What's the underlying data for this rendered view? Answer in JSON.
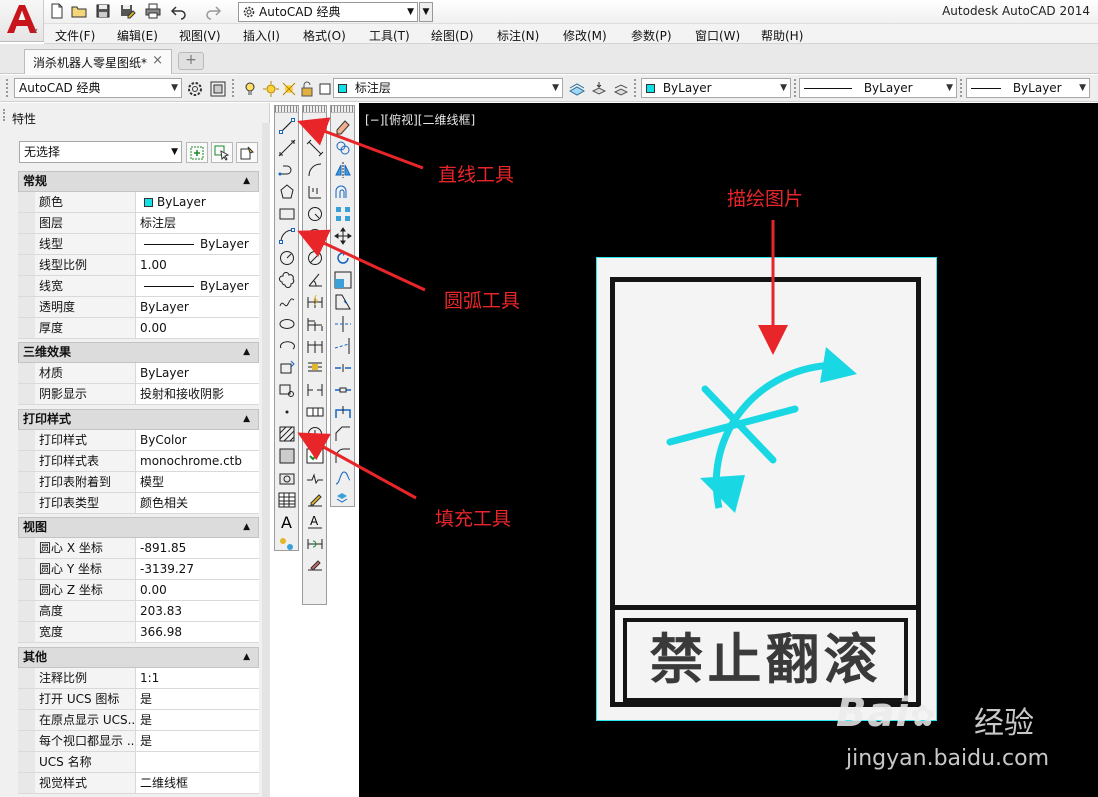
{
  "app": {
    "title": "Autodesk AutoCAD 2014",
    "workspace": "AutoCAD 经典"
  },
  "menu": [
    "文件(F)",
    "编辑(E)",
    "视图(V)",
    "插入(I)",
    "格式(O)",
    "工具(T)",
    "绘图(D)",
    "标注(N)",
    "修改(M)",
    "参数(P)",
    "窗口(W)",
    "帮助(H)"
  ],
  "tabs": {
    "active": "消杀机器人零星图纸*",
    "close": "×",
    "new": "+"
  },
  "toolbar": {
    "workspace": "AutoCAD 经典",
    "layer": "标注层",
    "color": "ByLayer",
    "linetype": "ByLayer",
    "lineweight": "ByLayer",
    "accent_color": "#14e0e8"
  },
  "properties": {
    "title": "特性",
    "selection": "无选择",
    "sections": {
      "general": {
        "title": "常规",
        "rows": [
          {
            "k": "颜色",
            "v": "ByLayer"
          },
          {
            "k": "图层",
            "v": "标注层"
          },
          {
            "k": "线型",
            "v": "ByLayer"
          },
          {
            "k": "线型比例",
            "v": "1.00"
          },
          {
            "k": "线宽",
            "v": "ByLayer"
          },
          {
            "k": "透明度",
            "v": "ByLayer"
          },
          {
            "k": "厚度",
            "v": "0.00"
          }
        ]
      },
      "threed": {
        "title": "三维效果",
        "rows": [
          {
            "k": "材质",
            "v": "ByLayer"
          },
          {
            "k": "阴影显示",
            "v": "投射和接收阴影"
          }
        ]
      },
      "plot": {
        "title": "打印样式",
        "rows": [
          {
            "k": "打印样式",
            "v": "ByColor"
          },
          {
            "k": "打印样式表",
            "v": "monochrome.ctb"
          },
          {
            "k": "打印表附着到",
            "v": "模型"
          },
          {
            "k": "打印表类型",
            "v": "颜色相关"
          }
        ]
      },
      "view": {
        "title": "视图",
        "rows": [
          {
            "k": "圆心 X 坐标",
            "v": "-891.85"
          },
          {
            "k": "圆心 Y 坐标",
            "v": "-3139.27"
          },
          {
            "k": "圆心 Z 坐标",
            "v": "0.00"
          },
          {
            "k": "高度",
            "v": "203.83"
          },
          {
            "k": "宽度",
            "v": "366.98"
          }
        ]
      },
      "misc": {
        "title": "其他",
        "rows": [
          {
            "k": "注释比例",
            "v": "1:1"
          },
          {
            "k": "打开 UCS 图标",
            "v": "是"
          },
          {
            "k": "在原点显示 UCS...",
            "v": "是"
          },
          {
            "k": "每个视口都显示 ...",
            "v": "是"
          },
          {
            "k": "UCS 名称",
            "v": ""
          },
          {
            "k": "视觉样式",
            "v": "二维线框"
          }
        ]
      }
    }
  },
  "viewport": {
    "label": "[−][俯视][二维线框]",
    "sign_text": "禁止翻滚",
    "sign_border_color": "#2fe6f0",
    "arrow_color": "#19d8e4"
  },
  "annotations": {
    "line_tool": "直线工具",
    "arc_tool": "圆弧工具",
    "fill_tool": "填充工具",
    "trace_image": "描绘图片",
    "color": "#e8262a"
  },
  "watermark": {
    "brand": "Bai",
    "brand_suffix": "经验",
    "url": "jingyan.baidu.com"
  }
}
